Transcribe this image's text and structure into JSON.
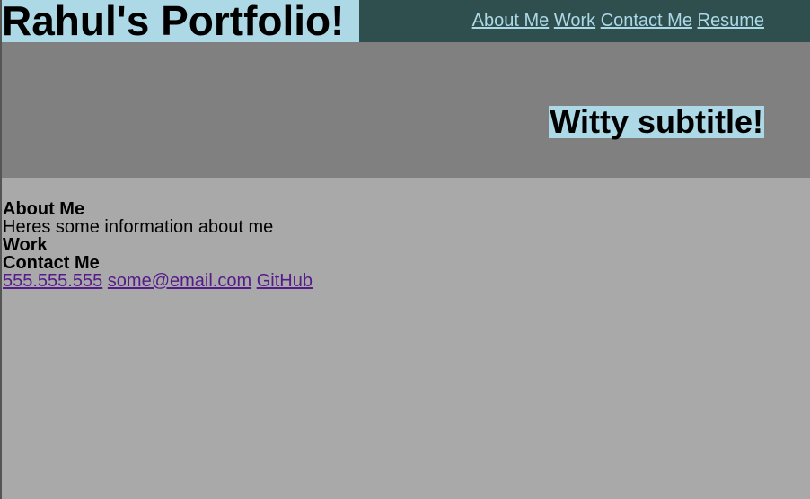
{
  "header": {
    "title": "Rahul's Portfolio!",
    "nav": [
      "About Me",
      "Work",
      "Contact Me",
      "Resume"
    ]
  },
  "hero": {
    "subtitle": "Witty subtitle!"
  },
  "main": {
    "about_heading": "About Me",
    "about_text": "Heres some information about me",
    "work_heading": "Work",
    "contact_heading": "Contact Me",
    "contact_links": [
      "555.555.555",
      "some@email.com",
      "GitHub"
    ]
  }
}
